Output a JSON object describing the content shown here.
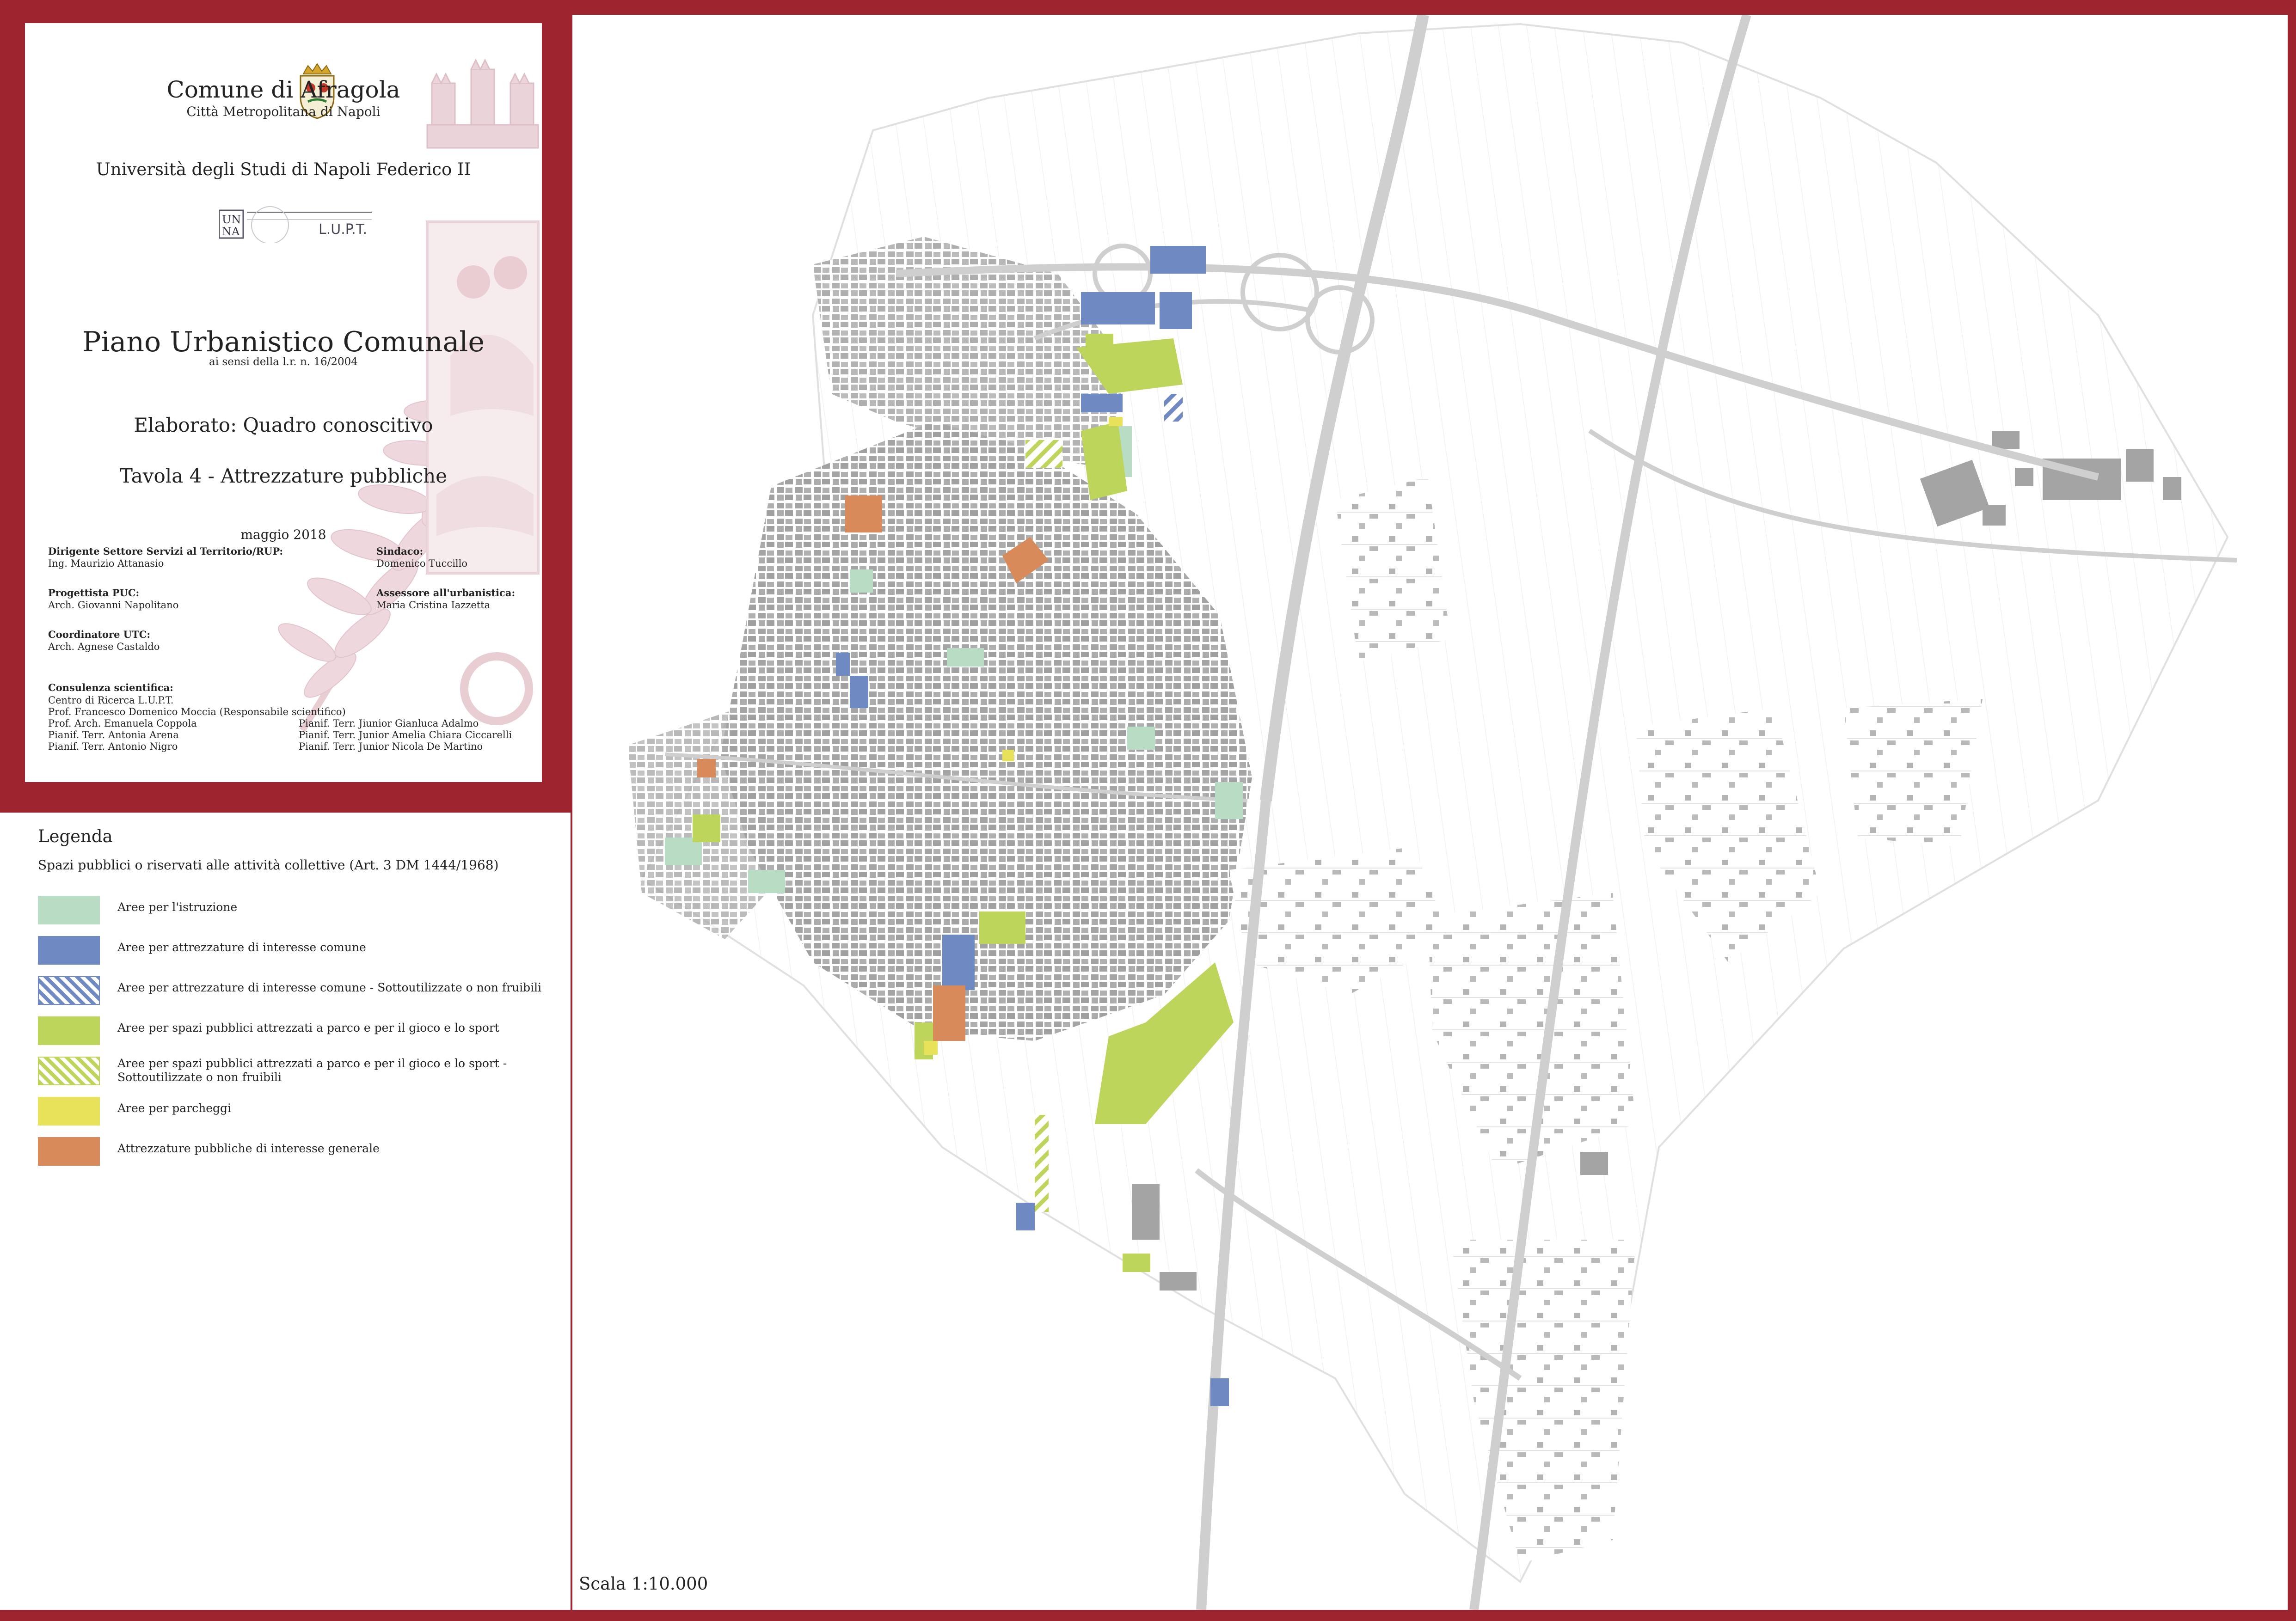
{
  "header": {
    "comune": "Comune di Afragola",
    "citta": "Città Metropolitana di Napoli",
    "universita": "Università degli Studi di Napoli Federico II",
    "lupt_logo_text": "L.U.P.T.",
    "plan_title": "Piano Urbanistico Comunale",
    "plan_subtitle": "ai sensi della l.r. n. 16/2004",
    "elaborato": "Elaborato: Quadro conoscitivo",
    "tavola": "Tavola 4 - Attrezzature pubbliche",
    "date": "maggio 2018"
  },
  "credits": {
    "dirigente_role": "Dirigente Settore Servizi al Territorio/RUP:",
    "dirigente_name": "Ing. Maurizio Attanasio",
    "progettista_role": "Progettista PUC:",
    "progettista_name": "Arch. Giovanni Napolitano",
    "coordinatore_role": "Coordinatore UTC:",
    "coordinatore_name": "Arch. Agnese Castaldo",
    "sindaco_role": "Sindaco:",
    "sindaco_name": "Domenico Tuccillo",
    "assessore_role": "Assessore all'urbanistica:",
    "assessore_name": "Maria Cristina Iazzetta",
    "consulenza_role": "Consulenza scientifica:",
    "consulenza_left": [
      "Centro di Ricerca L.U.P.T.",
      "Prof. Francesco Domenico Moccia (Responsabile scientifico)",
      "Prof. Arch. Emanuela Coppola",
      "Pianif. Terr. Antonia Arena",
      "Pianif. Terr. Antonio Nigro"
    ],
    "consulenza_right": [
      "Pianif. Terr. Jiunior Gianluca Adalmo",
      "Pianif. Terr. Junior Amelia Chiara Ciccarelli",
      "Pianif. Terr. Junior Nicola De Martino"
    ]
  },
  "legend": {
    "title": "Legenda",
    "subtitle": "Spazi pubblici o riservati alle attività collettive (Art. 3 DM 1444/1968)",
    "items": [
      {
        "label": "Aree per l'istruzione",
        "color": "#b9dcc4",
        "pattern": "solid"
      },
      {
        "label": "Aree per attrezzature di interesse comune",
        "color": "#6f8ac3",
        "pattern": "solid"
      },
      {
        "label": "Aree per attrezzature di interesse comune - Sottoutilizzate o non fruibili",
        "color": "#6f8ac3",
        "pattern": "hatch"
      },
      {
        "label": "Aree per spazi pubblici attrezzati a parco e per il gioco e lo sport",
        "color": "#bcd55a",
        "pattern": "solid"
      },
      {
        "label": "Aree per spazi pubblici attrezzati a parco e per il gioco e lo sport - Sottoutilizzate o non fruibili",
        "color": "#bcd55a",
        "pattern": "hatch"
      },
      {
        "label": "Aree per parcheggi",
        "color": "#e8e25a",
        "pattern": "solid"
      },
      {
        "label": "Attrezzature pubbliche di interesse generale",
        "color": "#d98a5b",
        "pattern": "solid"
      }
    ]
  },
  "map": {
    "scale": "Scala 1:10.000",
    "colors": {
      "buildings": "#a9a9a9",
      "roads": "#d6d6d6",
      "background": "#ffffff"
    }
  }
}
